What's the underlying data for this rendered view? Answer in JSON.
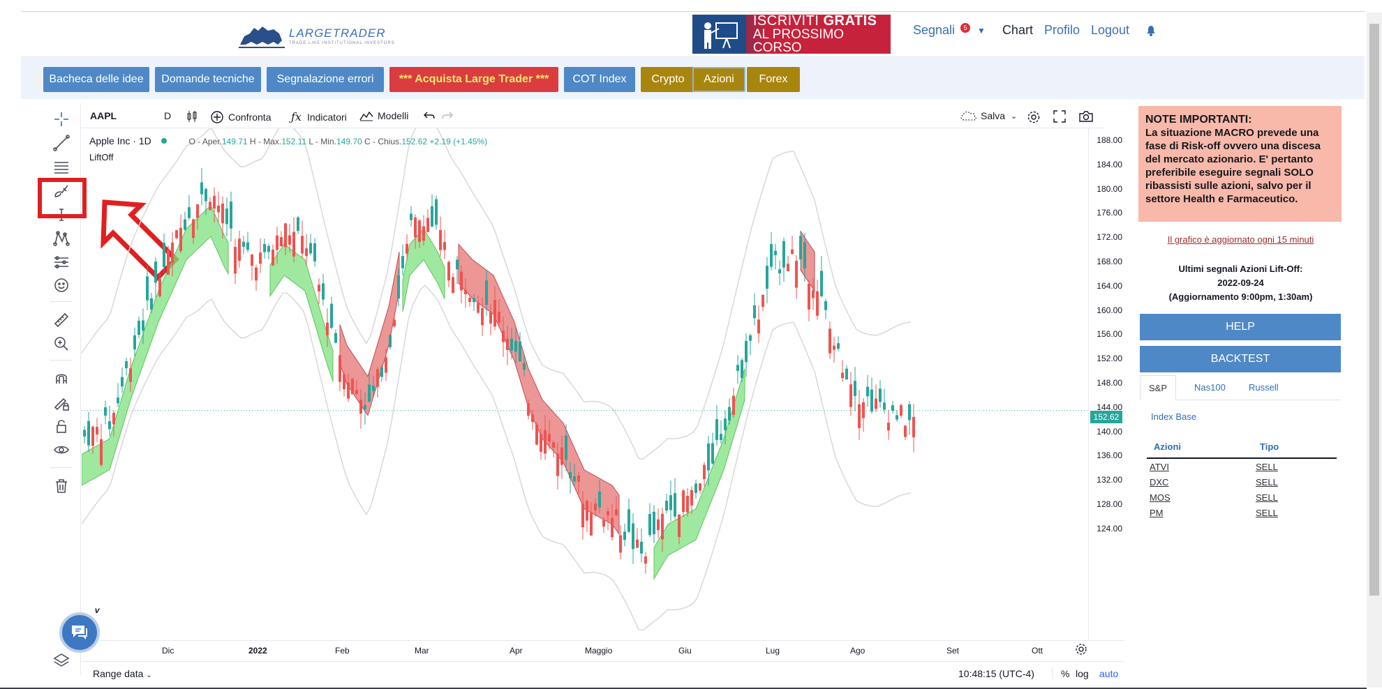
{
  "header": {
    "logo": {
      "main": "LARGE",
      "main2": "TRADER",
      "sub": "TRADE LIKE INSTITUTIONAL INVESTORS"
    },
    "banner": {
      "line1a": "ISCRIVITI",
      "line1b": "GRATIS",
      "line2": "AL PROSSIMO CORSO"
    },
    "nav": {
      "signals": "Segnali",
      "signals_badge": "5",
      "chart": "Chart",
      "profile": "Profilo",
      "logout": "Logout"
    }
  },
  "buttons": [
    {
      "label": "Bacheca delle idee"
    },
    {
      "label": "Domande tecniche"
    },
    {
      "label": "Segnalazione errori"
    },
    {
      "label": "*** Acquista Large Trader ***"
    },
    {
      "label": "COT Index"
    },
    {
      "label": "Crypto"
    },
    {
      "label": "Azioni"
    },
    {
      "label": "Forex"
    }
  ],
  "chart_toolbar": {
    "symbol": "AAPL",
    "interval": "D",
    "compare": "Confronta",
    "indicators": "Indicatori",
    "templates": "Modelli",
    "save": "Salva"
  },
  "legend": {
    "name": "Apple Inc · 1D",
    "open_label": "O - Aper.",
    "open": "149.71",
    "high_label": "H - Max.",
    "high": "152.11",
    "low_label": "L - Min.",
    "low": "149.70",
    "close_label": "C - Chius.",
    "close": "152.62",
    "change": "+2.19 (+1.45%)",
    "indicator": "LiftOff"
  },
  "yticks": [
    "188.00",
    "184.00",
    "180.00",
    "176.00",
    "172.00",
    "168.00",
    "164.00",
    "160.00",
    "156.00",
    "152.00",
    "148.00",
    "144.00",
    "140.00",
    "136.00",
    "132.00",
    "128.00",
    "124.00"
  ],
  "price_tag": "152.62",
  "xticks": [
    "Dic",
    "2022",
    "Feb",
    "Mar",
    "Apr",
    "Maggio",
    "Giu",
    "Lug",
    "Ago",
    "Set",
    "Ott"
  ],
  "bottom_bar": {
    "range": "Range data",
    "time": "10:48:15 (UTC-4)",
    "pct": "%",
    "log": "log",
    "auto": "auto"
  },
  "chart_data": {
    "type": "candlestick",
    "symbol": "AAPL",
    "ylim": [
      124,
      188
    ],
    "last_close": 152.62,
    "indicator": "LiftOff"
  },
  "right_panel": {
    "note_title": "NOTE IMPORTANTI:",
    "note_text": "La situazione MACRO prevede una fase di Risk-off ovvero una discesa del mercato azionario. E' pertanto preferibile eseguire segnali SOLO ribassisti sulle azioni, salvo per il settore Health e Farmaceutico.",
    "update_note": "Il grafico è aggiornato ogni 15 minuti",
    "last_signals": "Ultimi segnali Azioni Lift-Off:",
    "last_date": "2022-09-24",
    "last_update": "(Aggiornamento 9:00pm, 1:30am)",
    "help": "HELP",
    "backtest": "BACKTEST",
    "tabs": [
      "S&P",
      "Nas100",
      "Russell"
    ],
    "index_base": "Index Base",
    "table": {
      "headers": [
        "Azioni",
        "Tipo"
      ],
      "rows": [
        [
          "ATVI",
          "SELL"
        ],
        [
          "DXC",
          "SELL"
        ],
        [
          "MOS",
          "SELL"
        ],
        [
          "PM",
          "SELL"
        ]
      ]
    }
  },
  "colors": {
    "up": "#26a69a",
    "down": "#ef5350",
    "accent": "#4f88c6"
  }
}
